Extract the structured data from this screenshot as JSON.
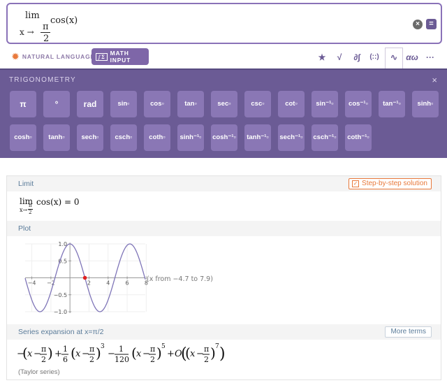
{
  "input": {
    "lim": "lim",
    "subscript": "x → ",
    "frac_num": "π",
    "frac_den": "2",
    "function": "cos(x)",
    "clear_icon": "clear-icon",
    "submit_icon": "equals-icon"
  },
  "modes": {
    "natural_language": "NATURAL LANGUAGE",
    "math_input": "MATH INPUT",
    "math_input_icon": "∫Σ"
  },
  "toolbar": {
    "icons": [
      {
        "name": "star-icon",
        "glyph": "★"
      },
      {
        "name": "sqrt-icon",
        "glyph": "√"
      },
      {
        "name": "calculus-icon",
        "glyph": "∂∫"
      },
      {
        "name": "matrix-icon",
        "glyph": "(::)"
      },
      {
        "name": "trig-wave-icon",
        "glyph": "∿"
      },
      {
        "name": "greek-icon",
        "glyph": "αω"
      },
      {
        "name": "more-icon",
        "glyph": "···"
      }
    ]
  },
  "trig_panel": {
    "title": "TRIGONOMETRY",
    "close": "×",
    "row1": [
      "π",
      "°",
      "rad",
      "sin▫",
      "cos▫",
      "tan▫",
      "sec▫",
      "csc▫",
      "cot▫",
      "sin⁻¹▫",
      "cos⁻¹▫",
      "tan⁻¹▫",
      "sinh▫"
    ],
    "row2": [
      "cosh▫",
      "tanh▫",
      "sech▫",
      "csch▫",
      "coth▫",
      "sinh⁻¹▫",
      "cosh⁻¹▫",
      "tanh⁻¹▫",
      "sech⁻¹▫",
      "csch⁻¹▫",
      "coth⁻¹▫"
    ]
  },
  "results": {
    "limit": {
      "title": "Limit",
      "button": "Step-by-step solution",
      "lim": "lim",
      "sub": "x→",
      "sub_num": "π",
      "sub_den": "2",
      "expr": "cos(x) = 0"
    },
    "plot": {
      "title": "Plot",
      "range_note": "(x from −4.7 to 7.9)"
    },
    "series": {
      "title": "Series expansion at x=π/2",
      "button": "More terms",
      "note": "(Taylor series)",
      "parts": {
        "minus": "−",
        "x": "x",
        "pi": "π",
        "two": "2",
        "plus": "+",
        "one": "1",
        "six": "6",
        "onetwenty": "120",
        "exp3": "3",
        "exp5": "5",
        "exp7": "7",
        "bigO": "O"
      }
    }
  },
  "chart_data": {
    "type": "line",
    "function": "cos(x)",
    "x_range": [
      -4.7,
      7.9
    ],
    "ylim": [
      -1.0,
      1.0
    ],
    "x_ticks": [
      "−4",
      "−2",
      "2",
      "4",
      "6",
      "8"
    ],
    "y_ticks": [
      "1.0",
      "0.5",
      "−0.5",
      "−1.0"
    ],
    "highlight_point": {
      "x": 1.5708,
      "y": 0
    },
    "line_color": "#7f75b8",
    "point_color": "#e02020"
  }
}
